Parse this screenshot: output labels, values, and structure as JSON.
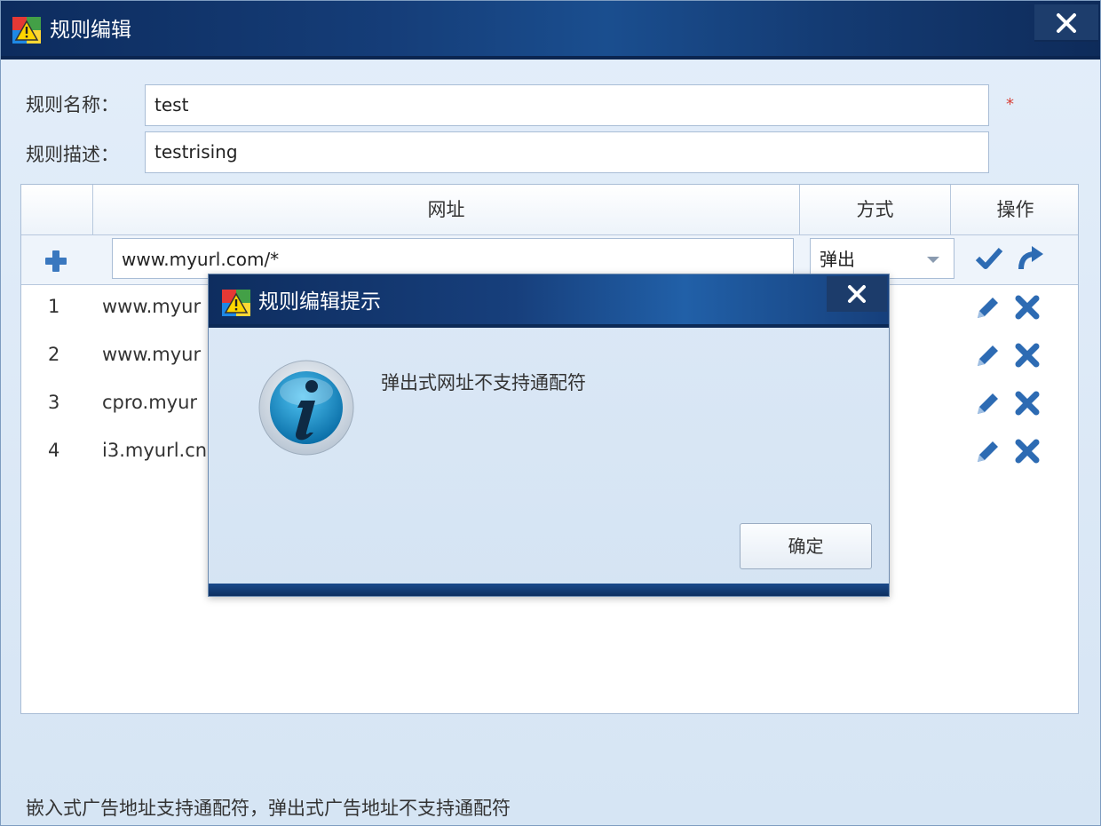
{
  "window": {
    "title": "规则编辑",
    "close_icon": "close-icon"
  },
  "form": {
    "name_label": "规则名称：",
    "name_value": "test",
    "required_mark": "*",
    "desc_label": "规则描述：",
    "desc_value": "testrising"
  },
  "table": {
    "headers": {
      "url": "网址",
      "mode": "方式",
      "actions": "操作"
    },
    "new_row": {
      "url_value": "www.myurl.com/*",
      "mode_value": "弹出"
    },
    "rows": [
      {
        "index": "1",
        "url": "www.myur"
      },
      {
        "index": "2",
        "url": "www.myur"
      },
      {
        "index": "3",
        "url": "cpro.myur"
      },
      {
        "index": "4",
        "url": "i3.myurl.cn"
      }
    ]
  },
  "footer_note": "嵌入式广告地址支持通配符，弹出式广告地址不支持通配符",
  "modal": {
    "title": "规则编辑提示",
    "message": "弹出式网址不支持通配符",
    "ok_label": "确定"
  },
  "colors": {
    "titlebar": "#153d78",
    "accent_red": "#d8423a",
    "icon_blue": "#2d6bb3"
  }
}
